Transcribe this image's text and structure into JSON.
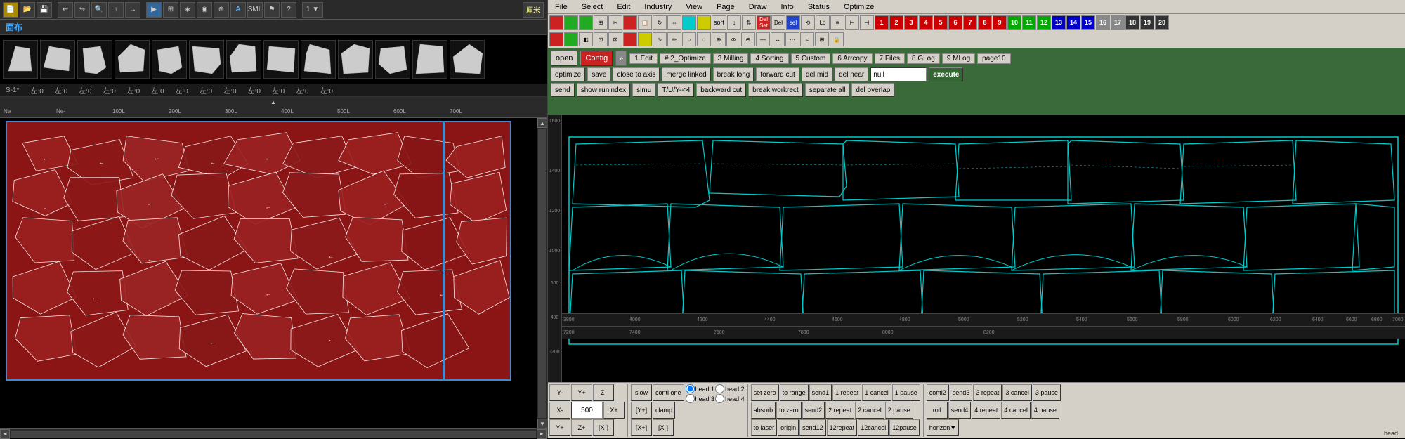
{
  "left_panel": {
    "face_label": "面布",
    "size_row": "S-1*",
    "sizes": [
      "左:0",
      "左:0",
      "左:0",
      "左:0",
      "左:0",
      "左:0",
      "左:0",
      "左:0",
      "左:0",
      "左:0",
      "左:0",
      "左:0",
      "左:0"
    ],
    "ruler_labels": [
      "Ne",
      "Ne-",
      "100L",
      "200L",
      "300L",
      "400L",
      "500L",
      "600L"
    ]
  },
  "right_panel": {
    "menu": [
      "File",
      "Select",
      "Edit",
      "Industry",
      "View",
      "Page",
      "Draw",
      "Info",
      "Status",
      "Optimize"
    ],
    "config_tabs": [
      "1 Edit",
      "# 2_Optimize",
      "3 Milling",
      "4 Sorting",
      "5 Custom",
      "6 Arrcopy",
      "7 Files",
      "8 GLog",
      "9 MLog",
      "page10"
    ],
    "buttons_open": "open",
    "buttons_config": "Config",
    "buttons_optimize": "optimize",
    "buttons_save": "save",
    "buttons_send": "send",
    "buttons_show": "show runindex",
    "buttons_simu": "simu",
    "op_buttons": [
      "close to axis",
      "merge linked",
      "break long",
      "forward cut",
      "del mid",
      "del near",
      "null",
      "execute",
      "T/U/Y-->I",
      "backward cut",
      "break workrect",
      "separate all",
      "del overlap"
    ],
    "bottom": {
      "yminus": "Y-",
      "yplus": "Y+",
      "zminus": "Z-",
      "slow": "slow",
      "contl_one": "contl one",
      "head3": "head 3",
      "head4": "head 4",
      "set_zero": "set zero",
      "to_range": "to range",
      "send1": "send1",
      "one_repeat": "1 repeat",
      "one_cancel": "1 cancel",
      "one_pause": "1 pause",
      "contl2": "contl2",
      "send3": "send3",
      "three_repeat": "3 repeat",
      "three_cancel": "3 cancel",
      "three_pause": "3 pause",
      "xminus": "X-",
      "val500": "500",
      "xplus": "X+",
      "yplus2": "[Y+]",
      "clamp": "clamp",
      "absorb": "absorb",
      "to_zero": "to zero",
      "send2": "send2",
      "two_repeat": "2 repeat",
      "two_cancel": "2 cancel",
      "two_pause": "2 pause",
      "roll": "roll",
      "send4": "send4",
      "four_repeat": "4 repeat",
      "four_cancel": "4 cancel",
      "four_pause": "4 pause",
      "yplus3": "Y+",
      "zminus2": "Z+",
      "xminus2": "[X-]",
      "xplus2": "[X+]",
      "head1_label": "head 1",
      "head2_label": "head 2",
      "to_laser": "to laser",
      "origin": "origin",
      "send12": "send12",
      "twelverepeated": "12repeat",
      "twelvecancelled": "12cancel",
      "twelvepause": "12pause",
      "horizon": "horizon▼"
    }
  },
  "icons": {
    "arrow_up": "▲",
    "arrow_down": "▼",
    "arrow_left": "◄",
    "arrow_right": "►",
    "expand": "»"
  }
}
